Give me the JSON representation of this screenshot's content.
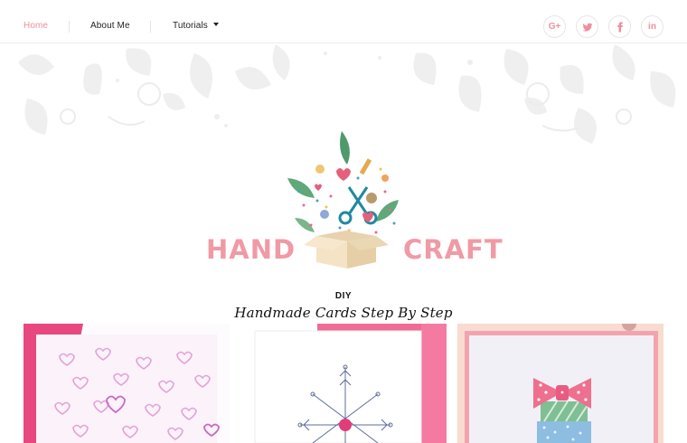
{
  "nav": {
    "items": [
      {
        "label": "Home",
        "active": true
      },
      {
        "label": "About Me",
        "active": false
      },
      {
        "label": "Tutorials",
        "active": false
      }
    ],
    "social": [
      {
        "name": "google-plus",
        "label": "G+"
      },
      {
        "name": "twitter"
      },
      {
        "name": "facebook"
      },
      {
        "name": "linkedin",
        "label": "in"
      }
    ]
  },
  "hero": {
    "brand_left": "HAND",
    "brand_right": "CRAFT",
    "kicker": "DIY",
    "tagline": "Handmade Cards Step By Step"
  },
  "colors": {
    "accent": "#ef8f9e",
    "brand": "#f09aa6",
    "pink_deep": "#e0457b",
    "pattern": "#efefef"
  },
  "cards": [
    {
      "name": "hearts-card"
    },
    {
      "name": "snowflake-card"
    },
    {
      "name": "bow-gift-card"
    }
  ]
}
